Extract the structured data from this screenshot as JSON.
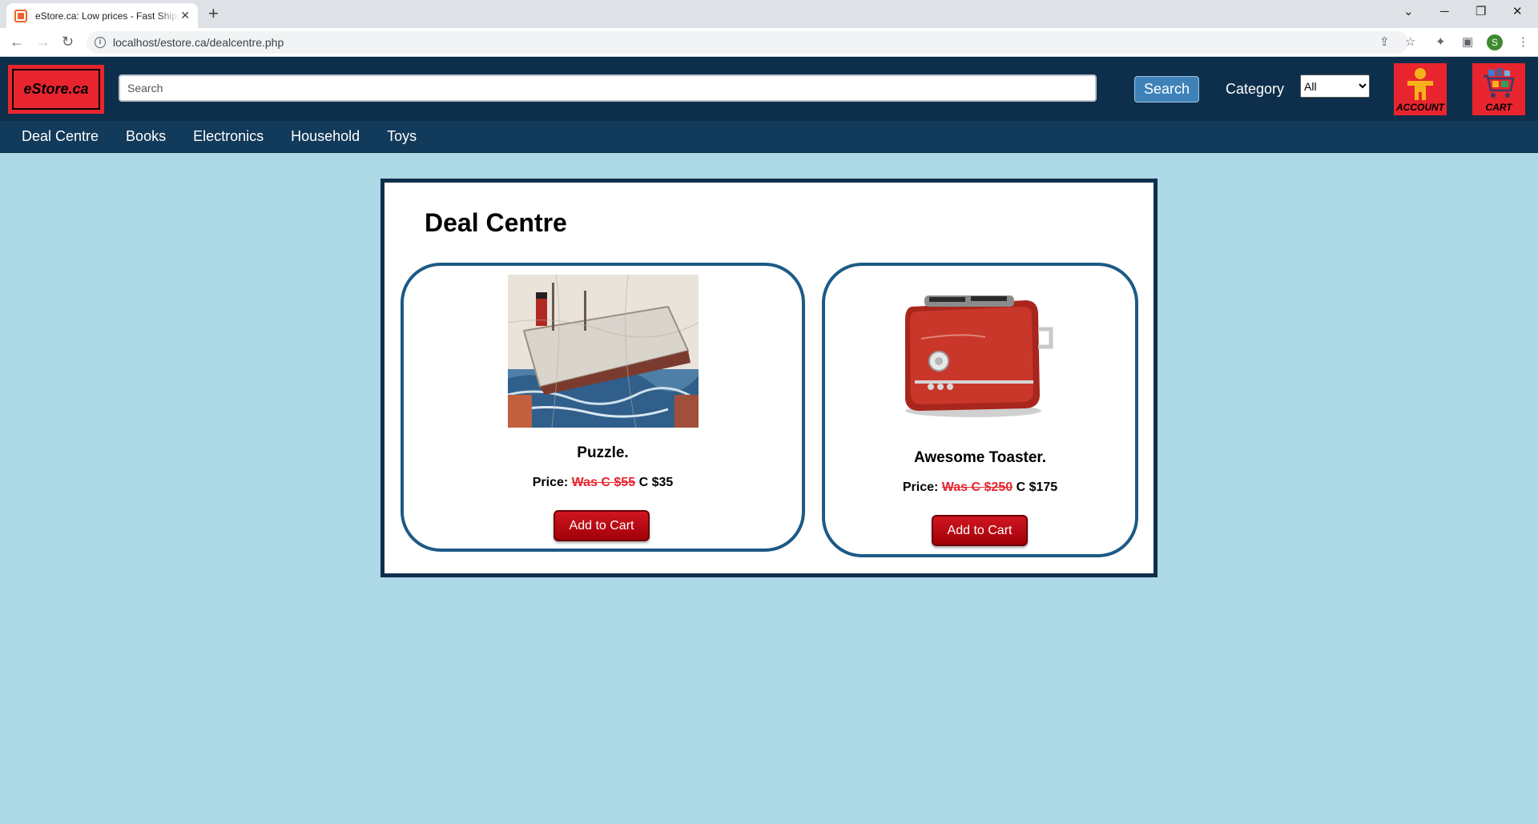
{
  "browser": {
    "tab_title": "eStore.ca: Low prices - Fast Shipping",
    "url": "localhost/estore.ca/dealcentre.php",
    "profile_initial": "S"
  },
  "header": {
    "logo_text": "eStore.ca",
    "search_placeholder": "Search",
    "search_button": "Search",
    "category_label": "Category",
    "category_selected": "All",
    "account_label": "ACCOUNT",
    "cart_label": "CART"
  },
  "nav": {
    "items": [
      "Deal Centre",
      "Books",
      "Electronics",
      "Household",
      "Toys"
    ]
  },
  "deals": {
    "title": "Deal Centre",
    "price_label": "Price:",
    "products": [
      {
        "name": "Puzzle.",
        "was": "Was C $55",
        "now": "C $35",
        "button": "Add to Cart",
        "image": "ship-puzzle-image"
      },
      {
        "name": "Awesome Toaster.",
        "was": "Was C $250",
        "now": "C $175",
        "button": "Add to Cart",
        "image": "red-toaster-image"
      }
    ]
  },
  "colors": {
    "page_bg": "#add8e6",
    "header_bg": "#0e2f4b",
    "accent_red": "#e8252f",
    "card_border": "#1d5a85"
  }
}
